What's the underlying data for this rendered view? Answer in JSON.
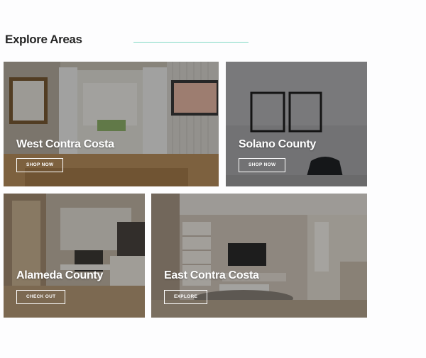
{
  "section": {
    "title": "Explore Areas",
    "accent_color": "#7fd8c4"
  },
  "cards": [
    {
      "title": "West Contra Costa",
      "button": "SHOP NOW"
    },
    {
      "title": "Solano County",
      "button": "SHOP NOW"
    },
    {
      "title": "Alameda County",
      "button": "CHECK OUT"
    },
    {
      "title": "East Contra Costa",
      "button": "EXPLORE"
    }
  ]
}
